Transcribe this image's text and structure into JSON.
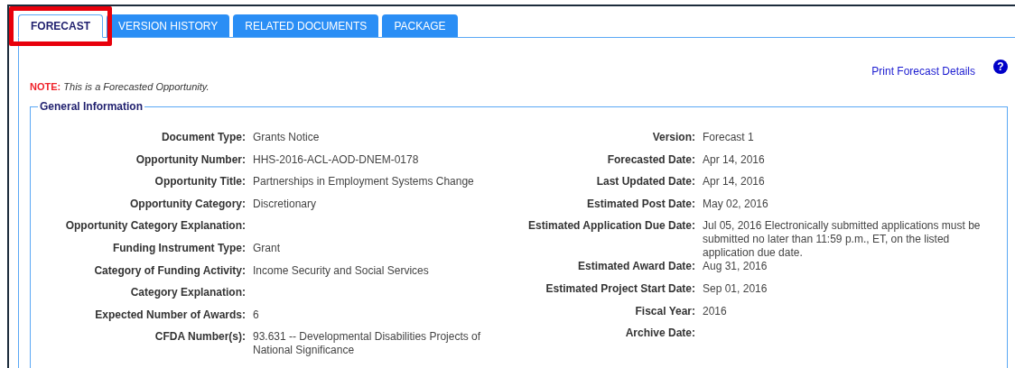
{
  "tabs": [
    {
      "label": "FORECAST",
      "selected": true,
      "highlighted": true
    },
    {
      "label": "VERSION HISTORY",
      "selected": false,
      "highlighted": false
    },
    {
      "label": "RELATED DOCUMENTS",
      "selected": false,
      "highlighted": false
    },
    {
      "label": "PACKAGE",
      "selected": false,
      "highlighted": false
    }
  ],
  "print_link": "Print Forecast Details",
  "help_icon": "?",
  "note": {
    "label": "NOTE:",
    "text": "This is a Forecasted Opportunity."
  },
  "general_information": {
    "title": "General Information",
    "left": [
      {
        "label": "Document Type:",
        "value": "Grants Notice"
      },
      {
        "label": "Opportunity Number:",
        "value": "HHS-2016-ACL-AOD-DNEM-0178"
      },
      {
        "label": "Opportunity Title:",
        "value": "Partnerships in Employment Systems Change"
      },
      {
        "label": "Opportunity Category:",
        "value": "Discretionary"
      },
      {
        "label": "Opportunity Category Explanation:"
      },
      {
        "label": "Funding Instrument Type:",
        "value": "Grant"
      },
      {
        "label": "Category of Funding Activity:",
        "value": "Income Security and Social Services"
      },
      {
        "label": "Category Explanation:"
      },
      {
        "label": "Expected Number of Awards:",
        "value": "6"
      },
      {
        "label": "CFDA Number(s):",
        "value": "93.631 -- Developmental Disabilities Projects of National Significance"
      }
    ],
    "right": [
      {
        "label": "Version:",
        "value": "Forecast 1"
      },
      {
        "label": "Forecasted Date:",
        "value": "Apr 14, 2016"
      },
      {
        "label": "Last Updated Date:",
        "value": "Apr 14, 2016"
      },
      {
        "label": "Estimated Post Date:",
        "value": "May 02, 2016"
      },
      {
        "label": "Estimated Application Due Date:",
        "value": "Jul 05, 2016  Electronically submitted applications must be submitted no later than 11:59 p.m., ET, on the listed application due date."
      },
      {
        "label": "Estimated Award Date:",
        "value": "Aug 31, 2016"
      },
      {
        "label": "Estimated Project Start Date:",
        "value": "Sep 01, 2016"
      },
      {
        "label": "Fiscal Year:",
        "value": "2016"
      },
      {
        "label": "Archive Date:"
      }
    ]
  }
}
